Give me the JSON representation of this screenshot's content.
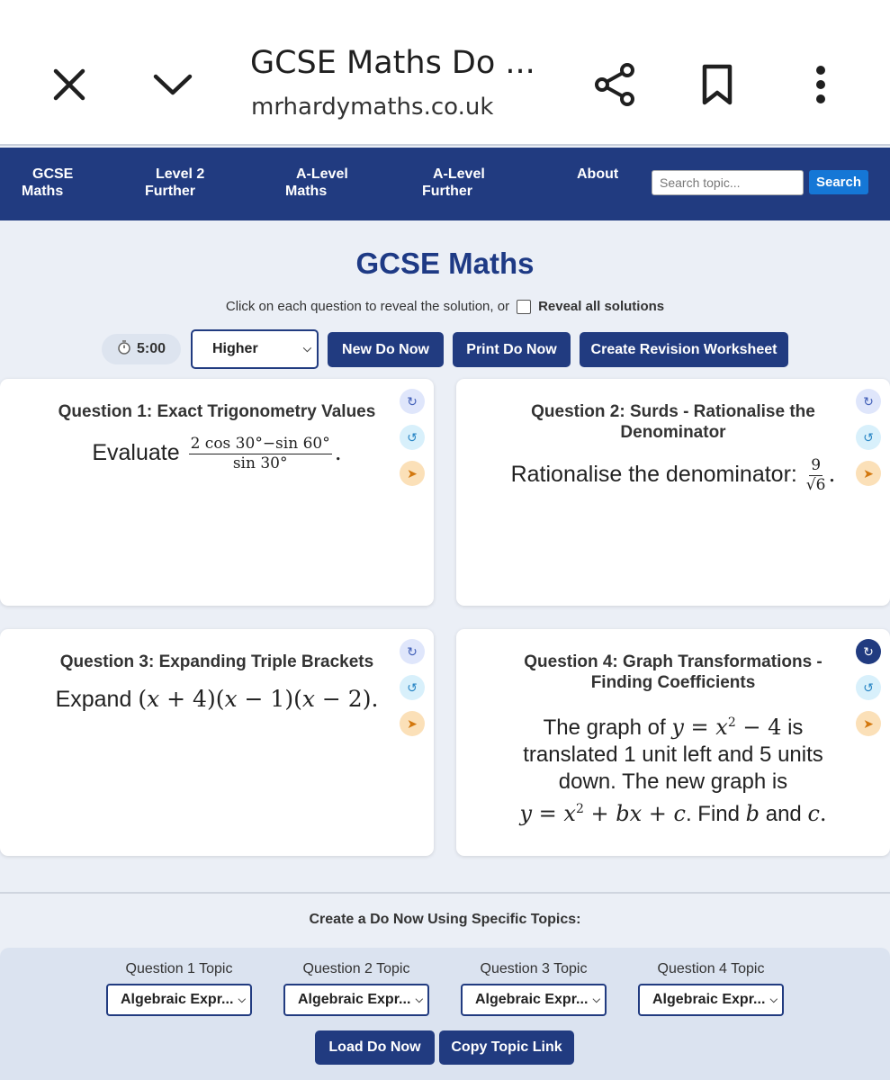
{
  "browser": {
    "title": "GCSE Maths Do ...",
    "url": "mrhardymaths.co.uk"
  },
  "nav": {
    "items": [
      {
        "label_line1": "GCSE",
        "label_line2": "Maths"
      },
      {
        "label_line1": "Level 2",
        "label_line2": "Further"
      },
      {
        "label_line1": "A-Level",
        "label_line2": "Maths"
      },
      {
        "label_line1": "A-Level",
        "label_line2": "Further"
      },
      {
        "label_line1": "About",
        "label_line2": ""
      }
    ],
    "search_placeholder": "Search topic...",
    "search_button": "Search"
  },
  "page": {
    "title": "GCSE Maths",
    "instructions": "Click on each question to reveal the solution, or",
    "reveal_all": "Reveal all solutions"
  },
  "controls": {
    "timer": "5:00",
    "level": "Higher",
    "new_do_now": "New Do Now",
    "print_do_now": "Print Do Now",
    "create_worksheet": "Create Revision Worksheet"
  },
  "questions": [
    {
      "heading": "Question 1: Exact Trigonometry Values",
      "prompt": "Evaluate"
    },
    {
      "heading": "Question 2: Surds - Rationalise the Denominator",
      "prompt": "Rationalise the denominator:"
    },
    {
      "heading": "Question 3: Expanding Triple Brackets",
      "prompt": "Expand"
    },
    {
      "heading": "Question 4: Graph Transformations - Finding Coefficients",
      "prompt_1": "The graph of",
      "prompt_2": "is",
      "prompt_3": "translated 1 unit left and 5 units",
      "prompt_4": "down. The new graph is",
      "prompt_5": ". Find",
      "prompt_6": "and"
    }
  ],
  "topics": {
    "heading": "Create a Do Now Using Specific Topics:",
    "columns": [
      {
        "label": "Question 1 Topic",
        "value": "Algebraic Expr..."
      },
      {
        "label": "Question 2 Topic",
        "value": "Algebraic Expr..."
      },
      {
        "label": "Question 3 Topic",
        "value": "Algebraic Expr..."
      },
      {
        "label": "Question 4 Topic",
        "value": "Algebraic Expr..."
      }
    ],
    "load_button": "Load Do Now",
    "copy_button": "Copy Topic Link"
  },
  "icons": {
    "close": "close-icon",
    "collapse": "chevron-down-icon",
    "share": "share-icon",
    "bookmark": "bookmark-icon",
    "menu": "more-vert-icon",
    "timer": "stopwatch-icon",
    "shuffle": "refresh-icon",
    "reset": "reset-icon",
    "next": "arrow-right-icon"
  },
  "colors": {
    "nav_bg": "#213b80",
    "accent": "#1e3a85",
    "search_btn": "#1577d6"
  }
}
